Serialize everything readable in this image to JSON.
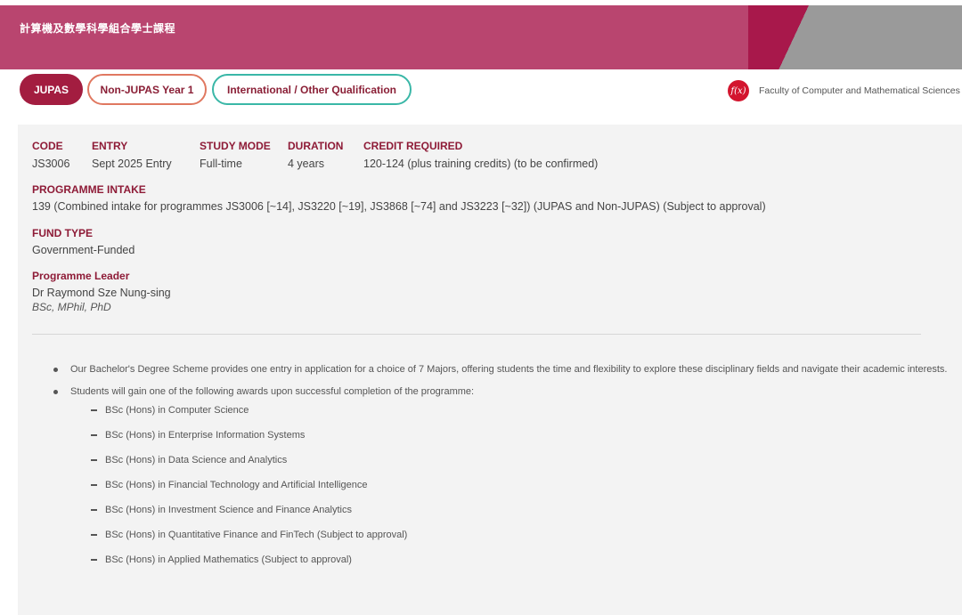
{
  "banner": {
    "title": "計算機及數學科學組合學士課程"
  },
  "tabs": [
    {
      "label": "JUPAS",
      "active": true
    },
    {
      "label": "Non-JUPAS Year 1",
      "active": false
    },
    {
      "label": "International / Other Qualification",
      "active": false
    }
  ],
  "faculty": {
    "logo": "f(x)",
    "name": "Faculty of Computer and Mathematical Sciences"
  },
  "info": {
    "code": {
      "label": "CODE",
      "value": "JS3006"
    },
    "entry": {
      "label": "ENTRY",
      "value": "Sept 2025 Entry"
    },
    "study_mode": {
      "label": "STUDY MODE",
      "value": "Full-time"
    },
    "duration": {
      "label": "DURATION",
      "value": "4 years"
    },
    "credit": {
      "label": "CREDIT REQUIRED",
      "value": "120-124 (plus training credits) (to be confirmed)"
    },
    "intake": {
      "label": "PROGRAMME INTAKE",
      "value": "139 (Combined intake for programmes JS3006 [~14], JS3220 [~19], JS3868 [~74] and JS3223 [~32]) (JUPAS and Non-JUPAS) (Subject to approval)"
    },
    "fund": {
      "label": "FUND TYPE",
      "value": "Government-Funded"
    },
    "leader": {
      "label": "Programme Leader",
      "name": "Dr Raymond Sze Nung-sing",
      "degrees": "BSc, MPhil, PhD"
    }
  },
  "bullets": [
    "Our Bachelor's Degree Scheme provides one entry in application for a choice of 7 Majors, offering students the time and flexibility to explore these disciplinary fields and navigate their academic interests.",
    "Students will gain one of the following awards upon successful completion of the programme:"
  ],
  "awards": [
    "BSc (Hons) in Computer Science",
    "BSc (Hons) in Enterprise Information Systems",
    "BSc (Hons) in Data Science and Analytics",
    "BSc (Hons) in Financial Technology and Artificial Intelligence",
    "BSc (Hons) in Investment Science and Finance Analytics",
    "BSc (Hons) in Quantitative Finance and FinTech (Subject to approval)",
    "BSc (Hons) in Applied Mathematics (Subject to approval)"
  ],
  "colors": {
    "banner": "#b9456f",
    "banner_accent": "#a8174a",
    "banner_grey": "#9a9a9a",
    "label": "#8e1b37",
    "tab_active": "#a31d40",
    "tab_nonjupas_border": "#e07860",
    "tab_intl_border": "#3ab7a7",
    "panel_bg": "#f3f3f3"
  }
}
